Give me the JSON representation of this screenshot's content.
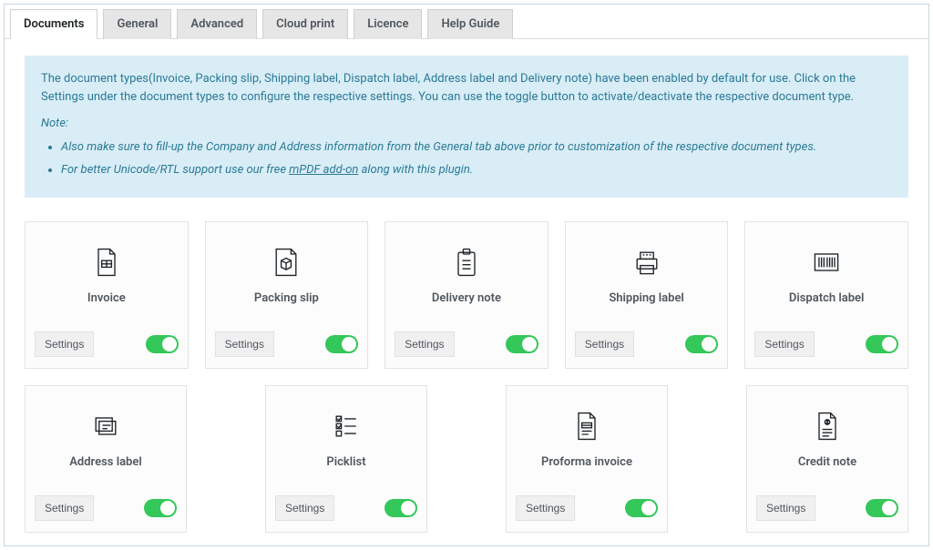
{
  "tabs": [
    {
      "label": "Documents",
      "active": true
    },
    {
      "label": "General",
      "active": false
    },
    {
      "label": "Advanced",
      "active": false
    },
    {
      "label": "Cloud print",
      "active": false
    },
    {
      "label": "Licence",
      "active": false
    },
    {
      "label": "Help Guide",
      "active": false
    }
  ],
  "notice": {
    "intro": "The document types(Invoice, Packing slip, Shipping label, Dispatch label, Address label and Delivery note) have been enabled by default for use. Click on the Settings under the document types to configure the respective settings. You can use the toggle button to activate/deactivate the respective document type.",
    "note_label": "Note:",
    "bullet1": "Also make sure to fill-up the Company and Address information from the General tab above prior to customization of the respective document types.",
    "bullet2_pre": "For better Unicode/RTL support use our free ",
    "bullet2_link": "mPDF add-on",
    "bullet2_post": " along with this plugin."
  },
  "settings_label": "Settings",
  "cards_row1": [
    {
      "id": "invoice",
      "label": "Invoice",
      "enabled": true,
      "icon": "invoice"
    },
    {
      "id": "packing-slip",
      "label": "Packing slip",
      "enabled": true,
      "icon": "box"
    },
    {
      "id": "delivery-note",
      "label": "Delivery note",
      "enabled": true,
      "icon": "clipboard"
    },
    {
      "id": "shipping-label",
      "label": "Shipping label",
      "enabled": true,
      "icon": "printer"
    },
    {
      "id": "dispatch-label",
      "label": "Dispatch label",
      "enabled": true,
      "icon": "barcode"
    }
  ],
  "cards_row2": [
    {
      "id": "address-label",
      "label": "Address label",
      "enabled": true,
      "icon": "labels"
    },
    {
      "id": "picklist",
      "label": "Picklist",
      "enabled": true,
      "icon": "checklist"
    },
    {
      "id": "proforma-invoice",
      "label": "Proforma invoice",
      "enabled": true,
      "icon": "invoice2"
    },
    {
      "id": "credit-note",
      "label": "Credit note",
      "enabled": true,
      "icon": "credit"
    }
  ]
}
